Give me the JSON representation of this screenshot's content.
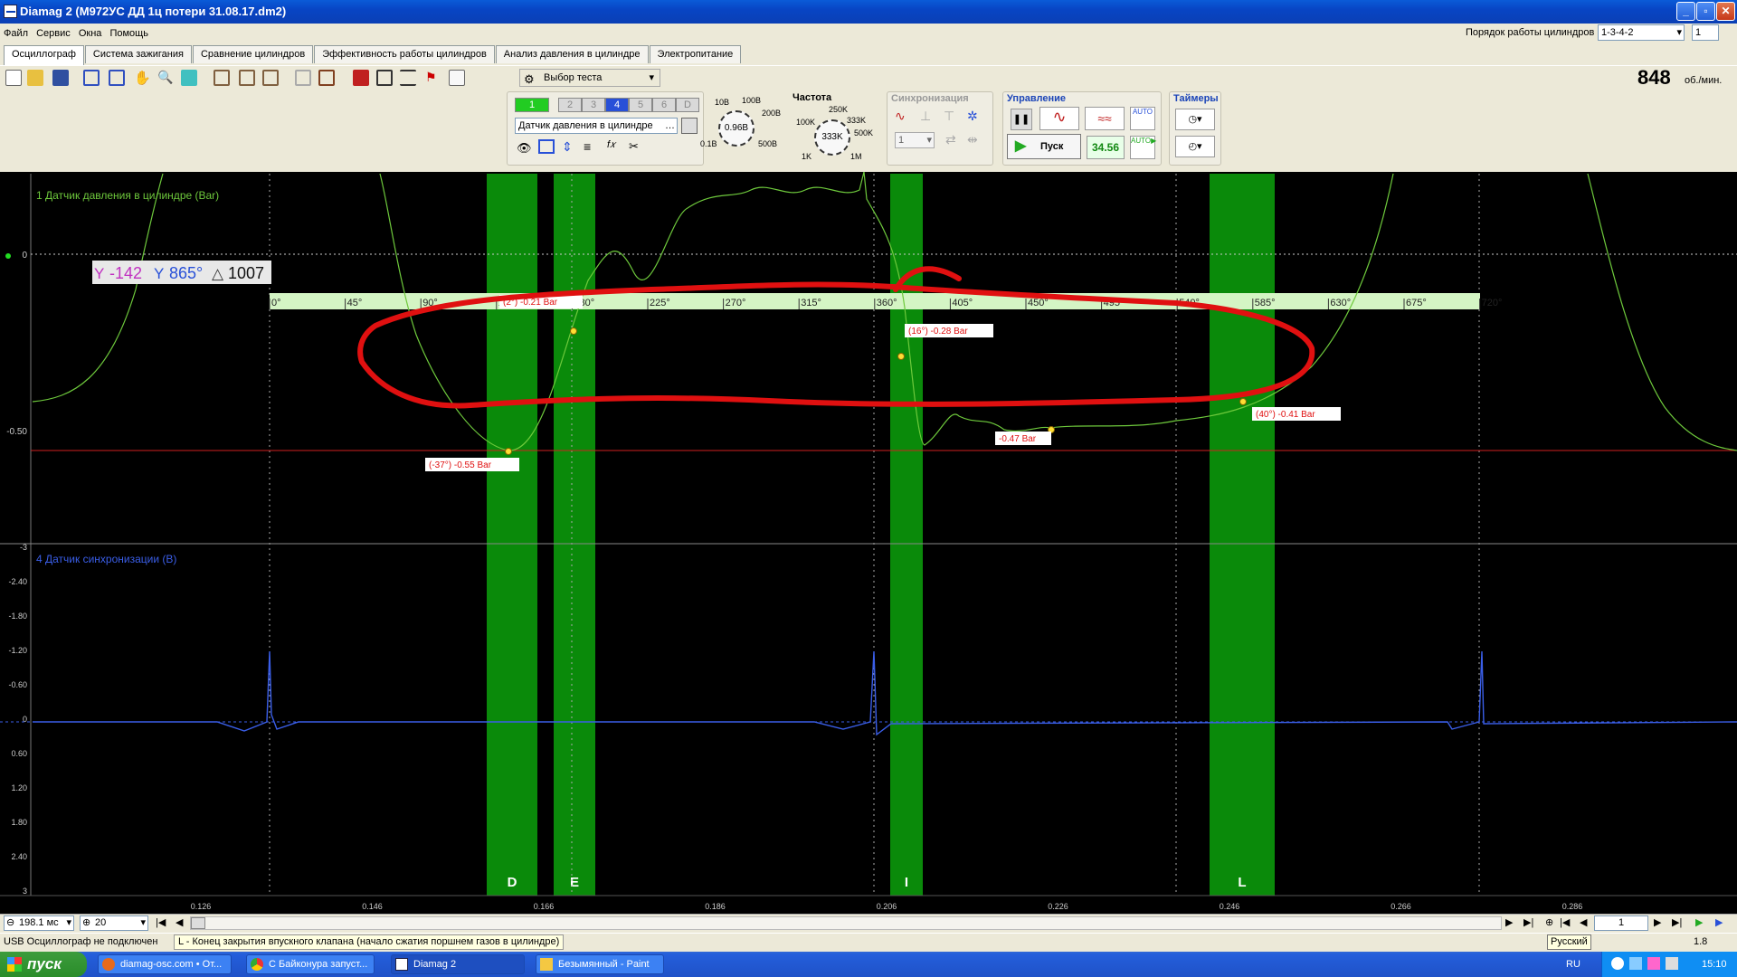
{
  "window": {
    "title": "Diamag 2 (М972УС ДД 1ц потери 31.08.17.dm2)"
  },
  "menu": [
    "Файл",
    "Сервис",
    "Окна",
    "Помощь"
  ],
  "cylinder_order": {
    "label": "Порядок работы цилиндров",
    "value": "1-3-4-2",
    "cyl": "1"
  },
  "tabs": [
    "Осциллограф",
    "Система зажигания",
    "Сравнение цилиндров",
    "Эффективность работы цилиндров",
    "Анализ давления в цилиндре",
    "Электропитание"
  ],
  "test_select": "Выбор теста",
  "rpm": {
    "value": "848",
    "unit": "об./мин."
  },
  "channels": {
    "buttons": [
      "1",
      "2",
      "3",
      "4",
      "5",
      "6",
      "D"
    ],
    "sensor": "Датчик давления в цилиндре",
    "scale_value": "0.96В",
    "scale_marks": [
      "10В",
      "100В",
      "200В",
      "500В",
      "0.1В"
    ]
  },
  "freq": {
    "title": "Частота",
    "value": "333K",
    "marks": [
      "100K",
      "250K",
      "333K",
      "500K",
      "1K",
      "1M"
    ]
  },
  "sync": {
    "title": "Синхронизация",
    "value": "1"
  },
  "control": {
    "title": "Управление",
    "start": "Пуск",
    "value": "34.56"
  },
  "timers": {
    "title": "Таймеры"
  },
  "scope": {
    "ch1_label": "1 Датчик давления в цилиндре (Bar)",
    "ch4_label": "4 Датчик синхронизации (В)",
    "ch1_yticks": [
      "0",
      "-0.50"
    ],
    "ch4_yticks": [
      "-3",
      "-2.40",
      "-1.80",
      "-1.20",
      "-0.60",
      "0",
      "0.60",
      "1.20",
      "1.80",
      "2.40",
      "3"
    ],
    "cursor_readout": {
      "a": "-142",
      "b": "865°",
      "delta": "1007"
    },
    "deg_ticks": [
      "0°",
      "45°",
      "90°",
      "135°",
      "180°",
      "225°",
      "270°",
      "315°",
      "360°",
      "405°",
      "450°",
      "495°",
      "540°",
      "585°",
      "630°",
      "675°",
      "720°"
    ],
    "time_ticks": [
      "0.126",
      "0.146",
      "0.166",
      "0.186",
      "0.206",
      "0.226",
      "0.246",
      "0.266",
      "0.286"
    ],
    "zones": [
      {
        "label": "D"
      },
      {
        "label": "E"
      },
      {
        "label": "I"
      },
      {
        "label": "L"
      }
    ],
    "markers": [
      {
        "text": "(2°) -0.21 Bar"
      },
      {
        "text": "(-37°) -0.55 Bar"
      },
      {
        "text": "(16°) -0.28 Bar"
      },
      {
        "text": "-0.47 Bar"
      },
      {
        "text": "(40°) -0.41 Bar"
      }
    ],
    "colors": {
      "ch1": "#6ec93c",
      "ch4": "#3a5ee8",
      "zone": "#0a8a0a",
      "annotation": "#e01010"
    }
  },
  "bottombar": {
    "timebase": "198.1 мс",
    "count": "20",
    "page": "1",
    "right_value": "1.8"
  },
  "status": {
    "left": "USB Осциллограф не подключен",
    "hint": "L - Конец закрытия впускного клапана (начало сжатия поршнем газов в цилиндре)",
    "lang": "Русский"
  },
  "taskbar": {
    "start": "пуск",
    "tasks": [
      "diamag-osc.com • От...",
      "С Байконура запуст...",
      "Diamag 2",
      "Безымянный - Paint"
    ],
    "lang": "RU",
    "clock": "15:10"
  }
}
